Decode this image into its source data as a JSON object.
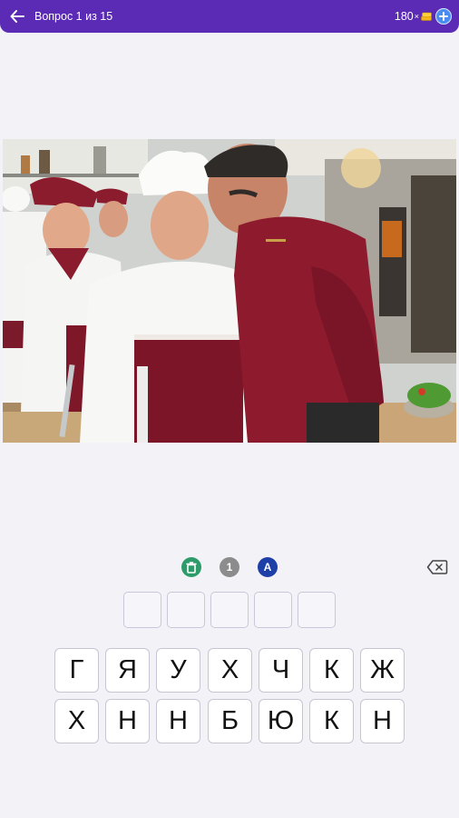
{
  "header": {
    "title": "Вопрос 1 из 15",
    "coins": "180",
    "multiplier": "×",
    "back_icon": "arrow-left-icon",
    "coin_icon": "coins-icon",
    "add_icon": "plus-icon"
  },
  "colors": {
    "header_bg": "#5b2bb5",
    "hint_remove": "#2e9b6a",
    "hint_reveal": "#8c8c8c",
    "hint_answer": "#1f3fa8"
  },
  "hints": [
    {
      "icon": "trash-icon",
      "glyph": "🗑"
    },
    {
      "icon": "one-letter-icon",
      "glyph": "1"
    },
    {
      "icon": "answer-icon",
      "glyph": "A"
    }
  ],
  "answer_slots": [
    "",
    "",
    "",
    "",
    ""
  ],
  "keyboard": {
    "row1": [
      "Г",
      "Я",
      "У",
      "Х",
      "Ч",
      "К",
      "Ж"
    ],
    "row2": [
      "Х",
      "Н",
      "Н",
      "Б",
      "Ю",
      "К",
      "Н"
    ]
  }
}
